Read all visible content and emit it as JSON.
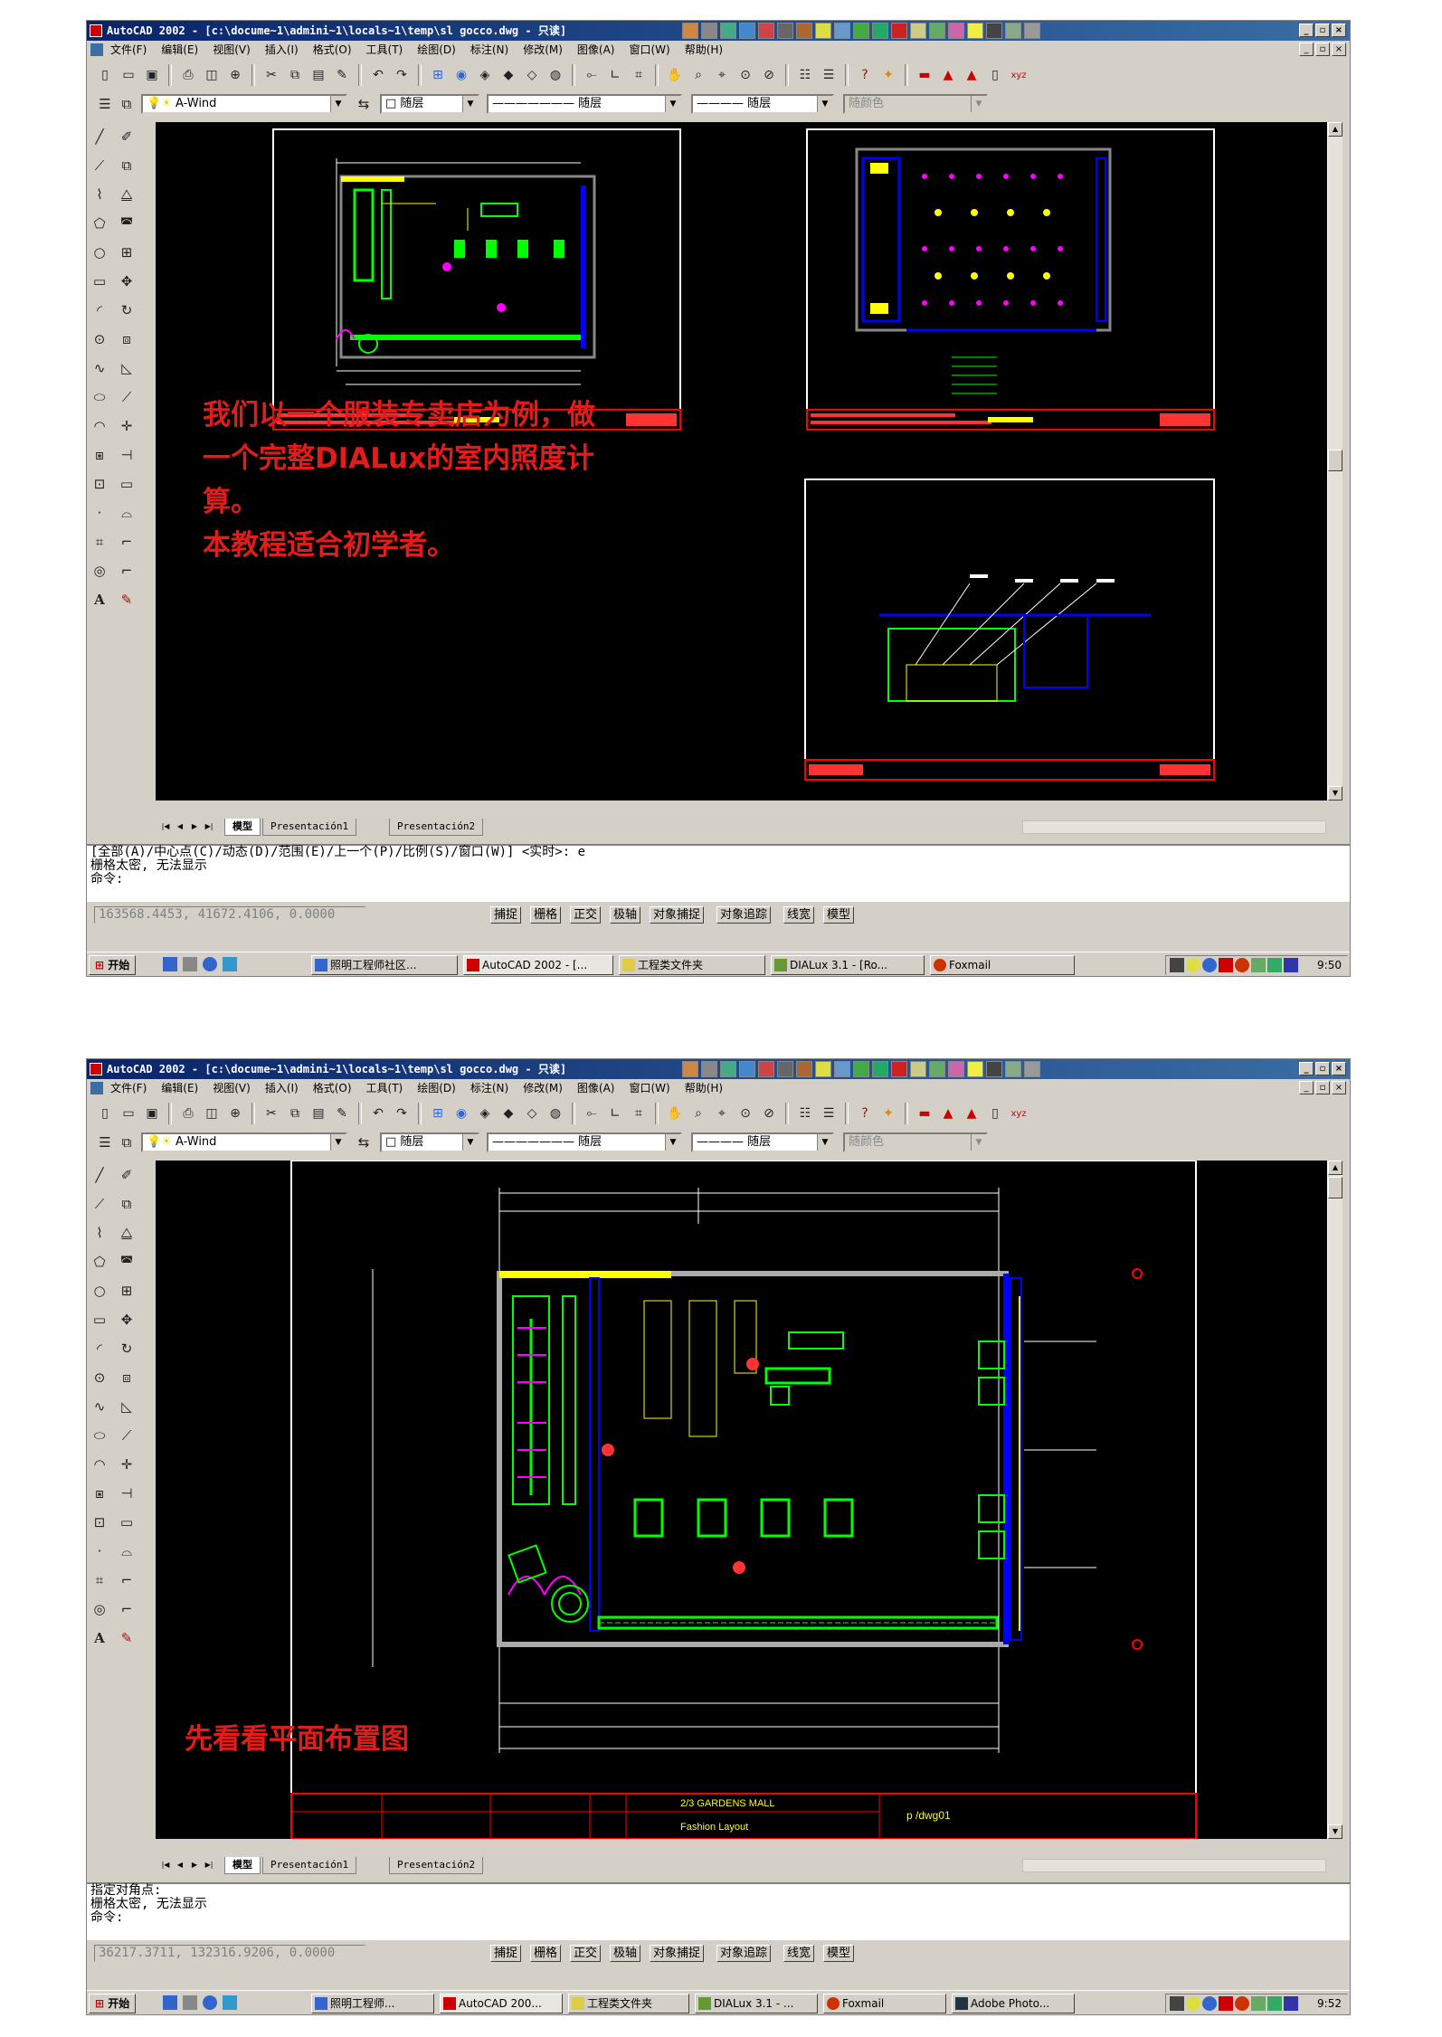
{
  "screenshots": [
    {
      "window_title": "AutoCAD 2002 - [c:\\docume~1\\admini~1\\locals~1\\temp\\sl gocco.dwg - 只读]",
      "menu": [
        "文件(F)",
        "编辑(E)",
        "视图(V)",
        "插入(I)",
        "格式(O)",
        "工具(T)",
        "绘图(D)",
        "标注(N)",
        "修改(M)",
        "图像(A)",
        "窗口(W)",
        "帮助(H)"
      ],
      "layer_name": "A-Wind",
      "color_value": "随层",
      "linetype_value": "随层",
      "lineweight_value": "随层",
      "plotstyle_value": "随颜色",
      "tabs": [
        "模型",
        "Presentación1",
        "Presentación2"
      ],
      "caption": "我们以一个服装专卖店为例，做\n一个完整DIALux的室内照度计\n算。\n本教程适合初学者。",
      "command_lines": [
        "[全部(A)/中心点(C)/动态(D)/范围(E)/上一个(P)/比例(S)/窗口(W)] <实时>: e",
        "栅格太密, 无法显示",
        "命令:"
      ],
      "coordinates": "163568.4453, 41672.4106, 0.0000",
      "status_buttons": [
        "捕捉",
        "栅格",
        "正交",
        "极轴",
        "对象捕捉",
        "对象追踪",
        "线宽",
        "模型"
      ],
      "start_label": "开始",
      "tasks": [
        "照明工程师社区...",
        "AutoCAD 2002 - [...",
        "工程类文件夹",
        "DIALux 3.1 - [Ro...",
        "Foxmail"
      ],
      "time": "9:50"
    },
    {
      "window_title": "AutoCAD 2002 - [c:\\docume~1\\admini~1\\locals~1\\temp\\sl gocco.dwg - 只读]",
      "menu": [
        "文件(F)",
        "编辑(E)",
        "视图(V)",
        "插入(I)",
        "格式(O)",
        "工具(T)",
        "绘图(D)",
        "标注(N)",
        "修改(M)",
        "图像(A)",
        "窗口(W)",
        "帮助(H)"
      ],
      "layer_name": "A-Wind",
      "color_value": "随层",
      "linetype_value": "随层",
      "lineweight_value": "随层",
      "plotstyle_value": "随颜色",
      "tabs": [
        "模型",
        "Presentación1",
        "Presentación2"
      ],
      "caption": "先看看平面布置图",
      "plan_title_block": {
        "project": "2/3 GARDENS MALL",
        "drawing": "Fashion Layout",
        "drawing_no": "p /dwg01"
      },
      "command_lines": [
        "指定对角点:",
        "栅格太密, 无法显示",
        "命令:"
      ],
      "coordinates": "36217.3711, 132316.9206, 0.0000",
      "status_buttons": [
        "捕捉",
        "栅格",
        "正交",
        "极轴",
        "对象捕捉",
        "对象追踪",
        "线宽",
        "模型"
      ],
      "start_label": "开始",
      "tasks": [
        "照明工程师...",
        "AutoCAD 200...",
        "工程类文件夹",
        "DIALux 3.1 - ...",
        "Foxmail",
        "Adobe Photo..."
      ],
      "time": "9:52"
    }
  ]
}
